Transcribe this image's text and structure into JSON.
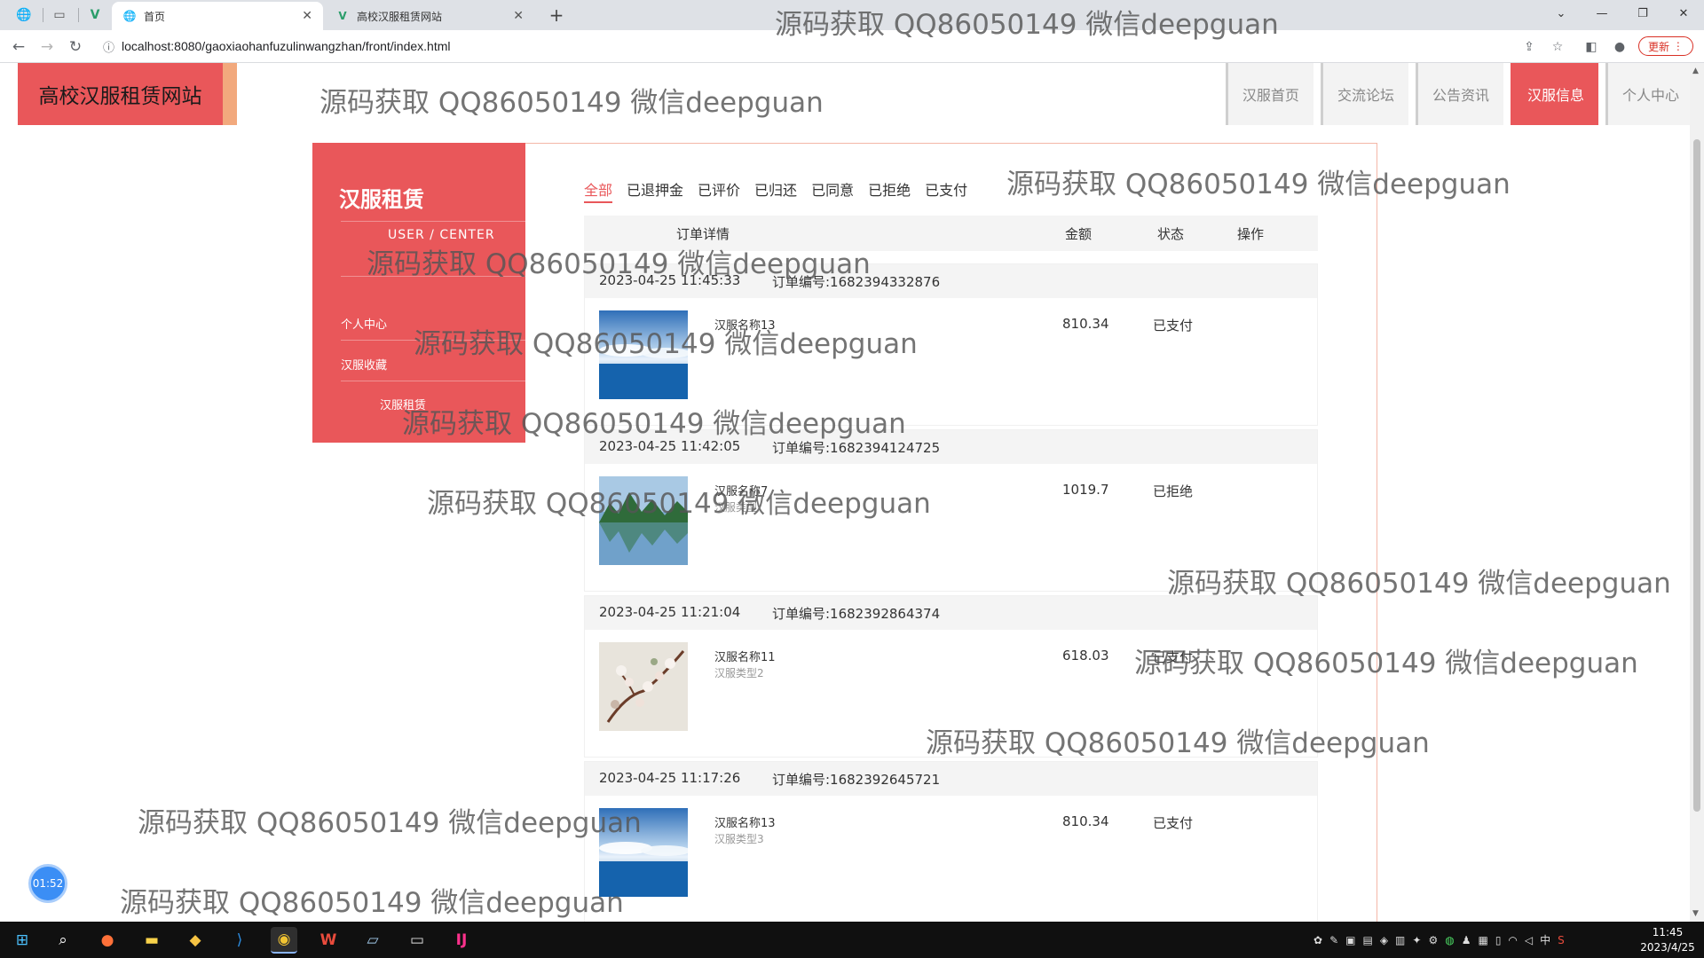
{
  "browser": {
    "tabs": [
      {
        "title": "首页",
        "favicon": "globe-icon"
      },
      {
        "title": "高校汉服租赁网站",
        "favicon": "vue-icon"
      }
    ],
    "url": "localhost:8080/gaoxiaohanfuzulinwangzhan/front/index.html",
    "update_label": "更新"
  },
  "site": {
    "logo_text": "高校汉服租赁网站",
    "nav": [
      "汉服首页",
      "交流论坛",
      "公告资讯",
      "汉服信息",
      "个人中心"
    ],
    "nav_active": "汉服信息"
  },
  "sidebar": {
    "title": "汉服租赁",
    "subtitle": "USER / CENTER",
    "items": [
      "个人中心",
      "汉服收藏",
      "汉服租赁"
    ]
  },
  "filters": [
    "全部",
    "已退押金",
    "已评价",
    "已归还",
    "已同意",
    "已拒绝",
    "已支付"
  ],
  "filter_active": "全部",
  "table_header": {
    "details": "订单详情",
    "amount": "金额",
    "status": "状态",
    "action": "操作"
  },
  "orders": [
    {
      "time": "2023-04-25 11:45:33",
      "order_no": "订单编号:1682394332876",
      "name": "汉服名称13",
      "type": "",
      "amount": "810.34",
      "status": "已支付",
      "image": "sea-sky"
    },
    {
      "time": "2023-04-25 11:42:05",
      "order_no": "订单编号:1682394124725",
      "name": "汉服名称7",
      "type": "汉服类型",
      "amount": "1019.7",
      "status": "已拒绝",
      "image": "lake-reflection"
    },
    {
      "time": "2023-04-25 11:21:04",
      "order_no": "订单编号:1682392864374",
      "name": "汉服名称11",
      "type": "汉服类型2",
      "amount": "618.03",
      "status": "已支付",
      "image": "blossom"
    },
    {
      "time": "2023-04-25 11:17:26",
      "order_no": "订单编号:1682392645721",
      "name": "汉服名称13",
      "type": "汉服类型3",
      "amount": "810.34",
      "status": "已支付",
      "image": "sea-sky"
    }
  ],
  "watermark": "源码获取 QQ86050149 微信deepguan",
  "timer": "01:52",
  "taskbar": {
    "ime": "中",
    "time": "11:45",
    "date": "2023/4/25"
  },
  "colors": {
    "accent": "#e9575a",
    "accent_light": "#f2a97d"
  }
}
